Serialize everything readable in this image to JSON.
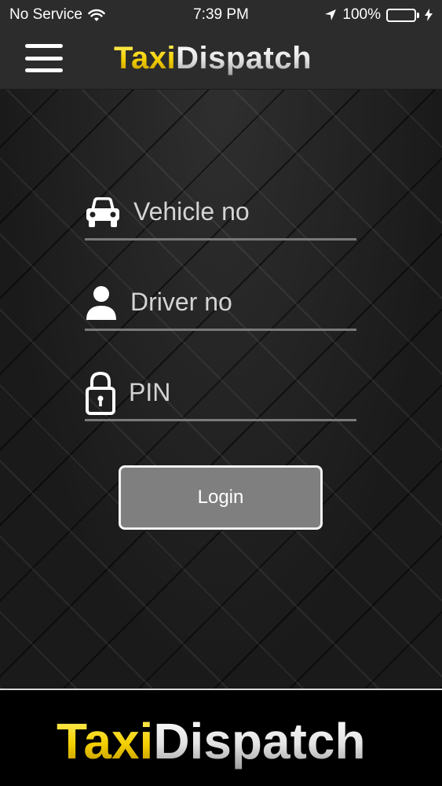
{
  "status_bar": {
    "carrier": "No Service",
    "time": "7:39 PM",
    "battery_percent": "100%",
    "battery_level": 1.0,
    "battery_color": "#4cd964"
  },
  "nav": {
    "menu_icon": "hamburger-menu-icon",
    "brand_part1": "Taxi",
    "brand_part2": "Dispatch"
  },
  "form": {
    "vehicle": {
      "placeholder": "Vehicle no",
      "value": "",
      "icon": "car-icon"
    },
    "driver": {
      "placeholder": "Driver no",
      "value": "",
      "icon": "person-icon"
    },
    "pin": {
      "placeholder": "PIN",
      "value": "",
      "icon": "lock-icon"
    },
    "login_label": "Login"
  },
  "footer": {
    "brand_part1": "Taxi",
    "brand_part2": "Dispatch"
  },
  "colors": {
    "brand_yellow": "#f4cf00",
    "brand_white": "#e3e3e3",
    "button_gray": "#7f7f7f"
  }
}
